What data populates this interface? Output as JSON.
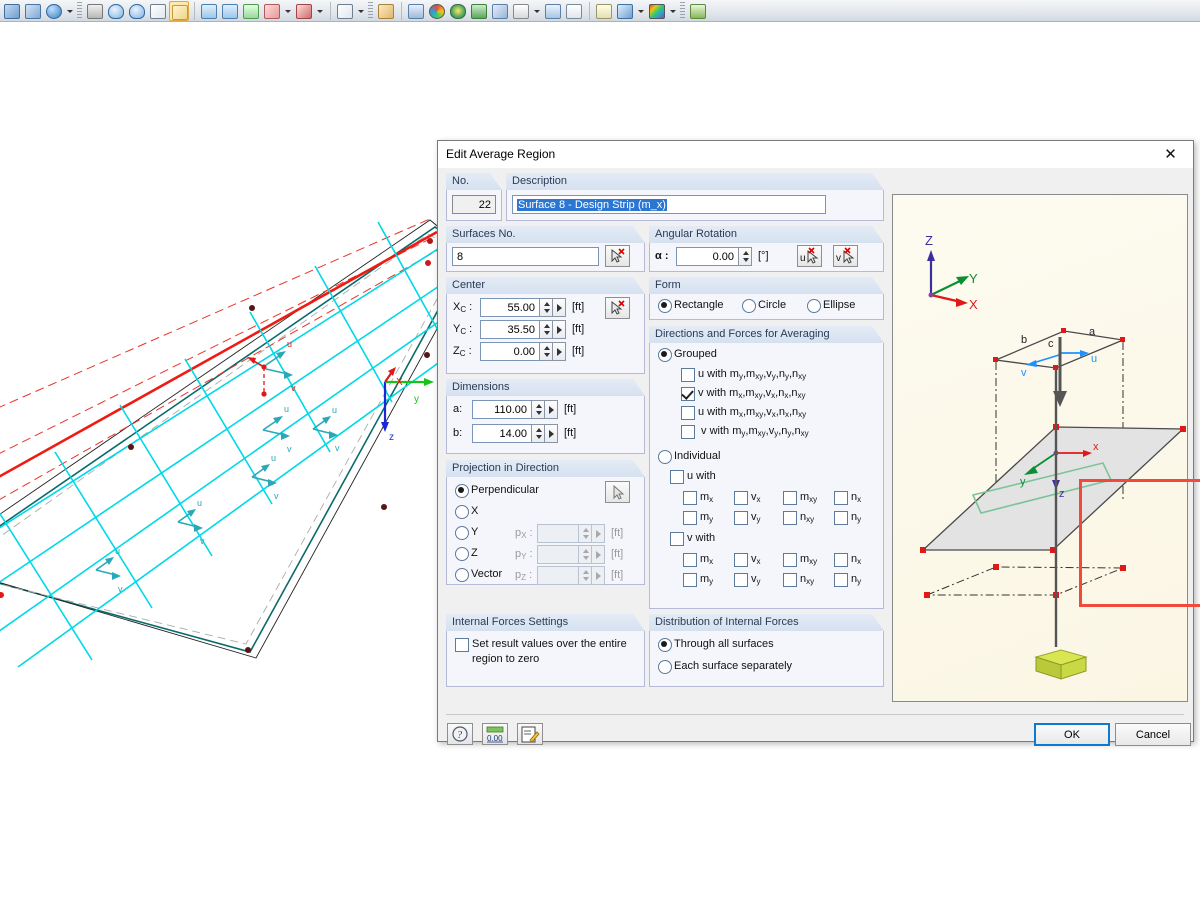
{
  "toolbar": {
    "icons": [
      "render-icon",
      "view-icon",
      "globe-icon",
      "dropdown-icon",
      "grip-icon",
      "select-icon",
      "zoom-in-icon",
      "zoom-out-icon",
      "box-icon",
      "render-solid-icon",
      "view-x-icon",
      "view-y-icon",
      "view-z-icon",
      "axis-icon",
      "dropdown-icon",
      "rotate-icon",
      "dropdown-icon",
      "cube-icon",
      "dropdown-icon",
      "grip-icon",
      "snap-icon",
      "section-icon",
      "contour-icon",
      "surface-result-icon",
      "support-icon",
      "diagram-icon",
      "pick-icon",
      "dropdown-icon",
      "line-result-icon",
      "table-icon",
      "report-icon",
      "paint-icon",
      "dropdown-icon",
      "color-scale-icon",
      "dropdown-icon",
      "grip-icon",
      "ruler-icon"
    ]
  },
  "dialog": {
    "title": "Edit Average Region",
    "close_icon": "close-icon",
    "no": {
      "label": "No.",
      "value": "22"
    },
    "description": {
      "label": "Description",
      "value": "Surface 8 - Design Strip (m_x)"
    },
    "surfaces_no": {
      "label": "Surfaces No.",
      "value": "8",
      "pick_icon": "pick-surface-icon"
    },
    "angular_rotation": {
      "label": "Angular Rotation",
      "alpha_label": "α :",
      "value": "0.00",
      "unit": "[°]",
      "pick_u_icon": "pick-u-direction-icon",
      "pick_v_icon": "pick-v-direction-icon"
    },
    "center": {
      "label": "Center",
      "unit": "[ft]",
      "pick_icon": "pick-center-icon",
      "rows": [
        {
          "label": "X",
          "sub": "C",
          "suffix": " :",
          "value": "55.00"
        },
        {
          "label": "Y",
          "sub": "C",
          "suffix": " :",
          "value": "35.50"
        },
        {
          "label": "Z",
          "sub": "C",
          "suffix": " :",
          "value": "0.00"
        }
      ]
    },
    "form": {
      "label": "Form",
      "options": [
        "Rectangle",
        "Circle",
        "Ellipse"
      ],
      "selected": "Rectangle"
    },
    "dimensions": {
      "label": "Dimensions",
      "unit": "[ft]",
      "rows": [
        {
          "label": "a:",
          "value": "110.00"
        },
        {
          "label": "b:",
          "value": "14.00"
        }
      ]
    },
    "projection": {
      "label": "Projection in Direction",
      "options": [
        "Perpendicular",
        "X",
        "Y",
        "Z",
        "Vector"
      ],
      "selected": "Perpendicular",
      "pick_icon": "pick-direction-icon",
      "vector_rows": [
        {
          "label": "p",
          "sub": "X",
          "suffix": " :",
          "value": "",
          "unit": "[ft]"
        },
        {
          "label": "p",
          "sub": "Y",
          "suffix": " :",
          "value": "",
          "unit": "[ft]"
        },
        {
          "label": "p",
          "sub": "Z",
          "suffix": " :",
          "value": "",
          "unit": "[ft]"
        }
      ]
    },
    "averaging": {
      "label": "Directions and Forces for Averaging",
      "mode_grouped": "Grouped",
      "mode_individual": "Individual",
      "selected_mode": "Grouped",
      "grouped_options": [
        {
          "text": "u with m",
          "parts": [
            [
              "u with m",
              "y"
            ],
            [
              ",m",
              "xy"
            ],
            [
              ",v",
              "y"
            ],
            [
              ",n",
              "y"
            ],
            [
              ",n",
              "xy"
            ]
          ],
          "checked": false
        },
        {
          "text": "v with m",
          "parts": [
            [
              "v with m",
              "x"
            ],
            [
              ",m",
              "xy"
            ],
            [
              ",v",
              "x"
            ],
            [
              ",n",
              "x"
            ],
            [
              ",n",
              "xy"
            ]
          ],
          "checked": true
        },
        {
          "text": "u with m",
          "parts": [
            [
              "u with m",
              "x"
            ],
            [
              ",m",
              "xy"
            ],
            [
              ",v",
              "x"
            ],
            [
              ",n",
              "x"
            ],
            [
              ",n",
              "xy"
            ]
          ],
          "checked": false
        },
        {
          "text": "v with m",
          "parts": [
            [
              " v with m",
              "y"
            ],
            [
              ",m",
              "xy"
            ],
            [
              ",v",
              "y"
            ],
            [
              ",n",
              "y"
            ],
            [
              ",n",
              "xy"
            ]
          ],
          "checked": false
        }
      ],
      "individual": {
        "u_label": "u with",
        "v_label": "v with",
        "u_checked": false,
        "v_checked": false,
        "components": [
          {
            "base": "m",
            "sub": "x"
          },
          {
            "base": "v",
            "sub": "x"
          },
          {
            "base": "m",
            "sub": "xy"
          },
          {
            "base": "n",
            "sub": "x"
          },
          {
            "base": "m",
            "sub": "y"
          },
          {
            "base": "v",
            "sub": "y"
          },
          {
            "base": "n",
            "sub": "xy"
          },
          {
            "base": "n",
            "sub": "y"
          }
        ]
      }
    },
    "internal_forces_settings": {
      "label": "Internal Forces Settings",
      "checkbox_line1": "Set result values over the entire",
      "checkbox_line2": "region to zero",
      "checked": false
    },
    "distribution": {
      "label": "Distribution of Internal Forces",
      "options": [
        "Through all surfaces",
        "Each surface separately"
      ],
      "selected": "Through all surfaces"
    },
    "footer": {
      "help_icon": "help-icon",
      "units_icon": "units-numbers-icon",
      "comment_icon": "comment-edit-icon",
      "ok_label": "OK",
      "cancel_label": "Cancel"
    },
    "preview": {
      "axis_z": "Z",
      "axis_y": "Y",
      "axis_x": "X",
      "label_a": "a",
      "label_b": "b",
      "label_c": "c",
      "label_u": "u",
      "label_v": "v",
      "local_x": "x",
      "local_y": "y",
      "local_z": "z"
    }
  },
  "annotation": {
    "name": "red-highlight-box",
    "color": "#f24a3a"
  },
  "viewport": {
    "axis_x": "X",
    "axis_y": "y",
    "axis_z": "z",
    "marker_u": "u",
    "marker_v": "v"
  }
}
